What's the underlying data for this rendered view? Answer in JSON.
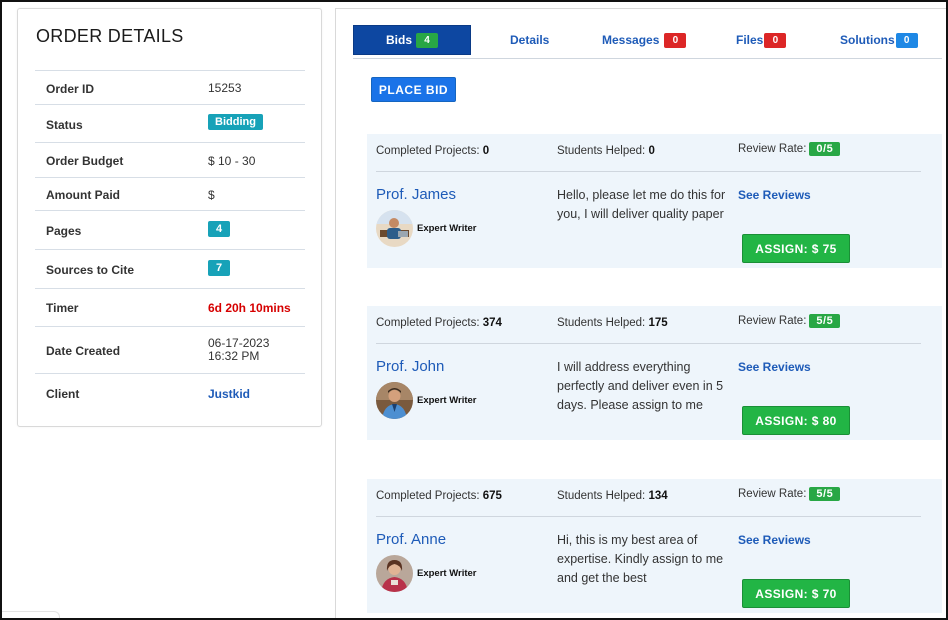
{
  "order_details": {
    "title": "ORDER DETAILS",
    "rows": [
      {
        "label": "Order ID",
        "value": "15253"
      },
      {
        "label": "Status",
        "value": "Bidding"
      },
      {
        "label": "Order Budget",
        "value": "$ 10 - 30"
      },
      {
        "label": "Amount Paid",
        "value": "$"
      },
      {
        "label": "Pages",
        "value": "4"
      },
      {
        "label": "Sources to Cite",
        "value": "7"
      },
      {
        "label": "Timer",
        "value": "6d 20h 10mins"
      },
      {
        "label": "Date Created",
        "value_line1": "06-17-2023",
        "value_line2": "16:32 PM"
      },
      {
        "label": "Client",
        "value": "Justkid"
      }
    ]
  },
  "tabs": [
    {
      "label": "Bids",
      "count": "4"
    },
    {
      "label": "Details"
    },
    {
      "label": "Messages",
      "count": "0"
    },
    {
      "label": "Files",
      "count": "0"
    },
    {
      "label": "Solutions",
      "count": "0"
    }
  ],
  "place_bid_label": "PLACE BID",
  "stat_labels": {
    "completed": "Completed Projects:",
    "helped": "Students Helped:",
    "review": "Review Rate:"
  },
  "bids": [
    {
      "completed_projects": "0",
      "students_helped": "0",
      "review_rate": "0/5",
      "name": "Prof. James",
      "role": "Expert Writer",
      "message": "Hello, please let me do this for you, I will deliver quality paper",
      "see_reviews": "See Reviews",
      "assign_label": "ASSIGN: $ 75"
    },
    {
      "completed_projects": "374",
      "students_helped": "175",
      "review_rate": "5/5",
      "name": "Prof. John",
      "role": "Expert Writer",
      "message": "I will address everything perfectly and deliver even in 5 days. Please assign to me",
      "see_reviews": "See Reviews",
      "assign_label": "ASSIGN: $ 80"
    },
    {
      "completed_projects": "675",
      "students_helped": "134",
      "review_rate": "5/5",
      "name": "Prof. Anne",
      "role": "Expert Writer",
      "message": "Hi, this is my best area of expertise. Kindly assign to me and get the best",
      "see_reviews": "See Reviews",
      "assign_label": "ASSIGN: $ 70"
    }
  ],
  "colors": {
    "primary_blue": "#0d47a1",
    "link_blue": "#1e5bb8",
    "teal_badge": "#17a2b8",
    "green": "#28a745",
    "red": "#dc2626",
    "card_bg": "#eef5fb",
    "timer_red": "#d60000"
  }
}
